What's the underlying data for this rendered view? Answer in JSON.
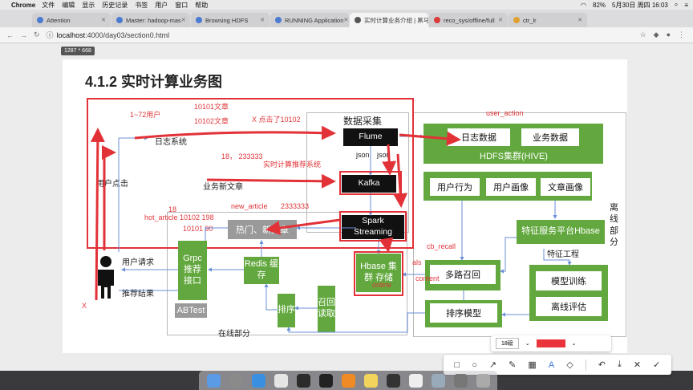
{
  "menubar": {
    "app": "Chrome",
    "items": [
      "文件",
      "编辑",
      "显示",
      "历史记录",
      "书签",
      "用户",
      "窗口",
      "帮助"
    ],
    "battery": "82%",
    "datetime": "5月30日 周四 16:03"
  },
  "tabs": [
    {
      "label": "Attention",
      "color": "#4a7bd1",
      "active": false
    },
    {
      "label": "Master: hadoop-mas",
      "color": "#4a7bd1",
      "active": false
    },
    {
      "label": "Browsing HDFS",
      "color": "#4a7bd1",
      "active": false
    },
    {
      "label": "RUNNING Application",
      "color": "#4a7bd1",
      "active": false
    },
    {
      "label": "实时计算业务介绍 | 黑马",
      "color": "#555555",
      "active": true
    },
    {
      "label": "reco_sys/offline/full",
      "color": "#d93b3b",
      "active": false
    },
    {
      "label": "ctr_lr",
      "color": "#e0a030",
      "active": false
    }
  ],
  "address": {
    "host": "localhost",
    "path": ":4000/day03/section0.html"
  },
  "size_chip": "1287 * 668",
  "slide": {
    "title": "4.1.2 实时计算业务图",
    "labels": {
      "data_collect": "数据采集",
      "log_system": "日志系统",
      "user_click": "用户点击",
      "biz_new_article": "业务新文章",
      "user_request": "用户请求",
      "rec_result": "推荐结果",
      "online_part": "在线部分",
      "offline_part": "离线部分",
      "feature_eng": "特征工程",
      "json1": "json",
      "json2": "json"
    },
    "boxes": {
      "flume": "Flume",
      "kafka": "Kafka",
      "spark": "Spark Streaming",
      "hot_new": "热门、新文章",
      "hbase": "Hbase 集群 存储",
      "grpc": "Grpc 推荐 接口",
      "abtest": "ABTest",
      "redis": "Redis 缓存",
      "sort": "排序",
      "recall_read": "召回读取",
      "log_data": "日志数据",
      "biz_data": "业务数据",
      "hdfs": "HDFS集群(HIVE)",
      "user_behavior": "用户行为",
      "user_profile": "用户画像",
      "article_profile": "文章画像",
      "feature_platform": "特征服务平台Hbase",
      "multi_recall": "多路召回",
      "sort_model": "排序模型",
      "model_train": "模型训练",
      "offline_eval": "离线评估"
    },
    "annotations": {
      "users": "1~72用户",
      "a1": "10101文章",
      "a2": "10102文章",
      "x_clicked": "X 点击了10102",
      "nums": "18，  233333",
      "rt_sys": "实时计算推荐系统",
      "new_article": "new_article",
      "n233": "2333333",
      "n18": "18",
      "hot_article": "hot_article 10102   198",
      "h10101": "10101   90",
      "user_action": "user_action",
      "cb_recall": "cb_recall",
      "als": "als",
      "content": "content",
      "online": "online",
      "x": "X"
    }
  },
  "toolbar": {
    "font_size": "18磅",
    "color": "#e8343a"
  }
}
